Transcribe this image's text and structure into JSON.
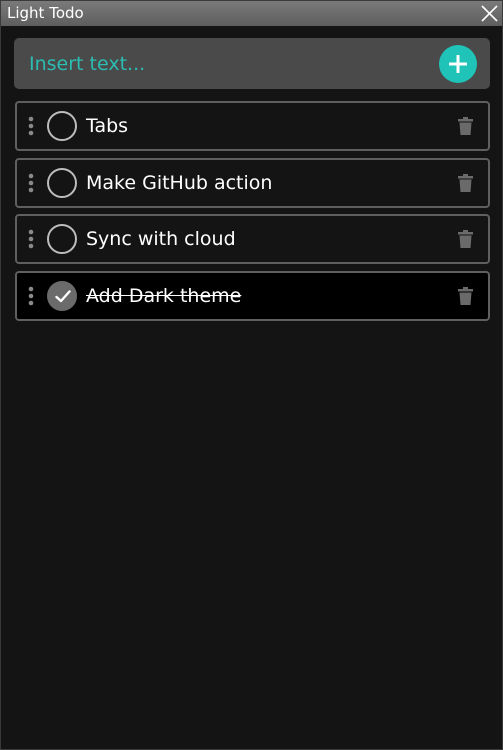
{
  "window": {
    "title": "Light Todo"
  },
  "input": {
    "placeholder": "Insert text...",
    "value": ""
  },
  "todos": [
    {
      "label": "Tabs",
      "done": false
    },
    {
      "label": "Make GitHub action",
      "done": false
    },
    {
      "label": "Sync with cloud",
      "done": false
    },
    {
      "label": "Add Dark theme",
      "done": true
    }
  ],
  "colors": {
    "accent": "#1fc3b8",
    "placeholder": "#2bbdb2",
    "background": "#141414",
    "input_bg": "#4a4a4a",
    "item_border": "#5f5f5f"
  },
  "icons": {
    "close": "close-icon",
    "add": "plus-icon",
    "drag": "drag-handle-icon",
    "check": "checkmark-icon",
    "delete": "trash-icon"
  }
}
